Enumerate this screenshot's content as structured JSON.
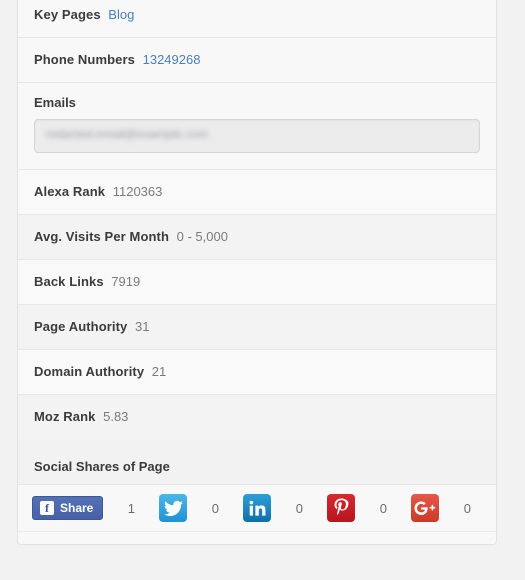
{
  "card": {
    "rows": [
      {
        "label": "Key Pages",
        "value": "Blog",
        "value_type": "link",
        "name": "key-pages"
      },
      {
        "label": "Phone Numbers",
        "value": "13249268",
        "value_type": "link",
        "name": "phone-numbers"
      },
      {
        "label": "Alexa Rank",
        "value": "1120363",
        "value_type": "text",
        "name": "alexa-rank"
      },
      {
        "label": "Avg. Visits Per Month",
        "value": "0 - 5,000",
        "value_type": "text",
        "name": "avg-visits-per-month"
      },
      {
        "label": "Back Links",
        "value": "7919",
        "value_type": "text",
        "name": "back-links"
      },
      {
        "label": "Page Authority",
        "value": "31",
        "value_type": "text",
        "name": "page-authority"
      },
      {
        "label": "Domain Authority",
        "value": "21",
        "value_type": "text",
        "name": "domain-authority"
      },
      {
        "label": "Moz Rank",
        "value": "5.83",
        "value_type": "text",
        "name": "moz-rank"
      }
    ],
    "emails": {
      "label": "Emails",
      "value": "redacted.email@example.com",
      "placeholder": ""
    },
    "social": {
      "title": "Social Shares of Page",
      "items": [
        {
          "network": "facebook",
          "icon": "facebook-share-icon",
          "label": "Share",
          "count": "1"
        },
        {
          "network": "twitter",
          "icon": "twitter-icon",
          "label": "",
          "count": "0"
        },
        {
          "network": "linkedin",
          "icon": "linkedin-icon",
          "label": "",
          "count": "0"
        },
        {
          "network": "pinterest",
          "icon": "pinterest-icon",
          "label": "",
          "count": "0"
        },
        {
          "network": "googleplus",
          "icon": "google-plus-icon",
          "label": "",
          "count": "0"
        }
      ]
    }
  },
  "colors": {
    "link": "#4a7ebb",
    "label": "#3b3b3b",
    "value": "#7a7a7a",
    "facebook": "#3b5998",
    "twitter": "#29a3dc",
    "linkedin": "#1982c4",
    "pinterest": "#cb2027",
    "googleplus": "#dd4b39",
    "row_odd": "#f9f9f9",
    "row_even": "#f3f3f3",
    "page_bg": "#f2f2f2"
  }
}
